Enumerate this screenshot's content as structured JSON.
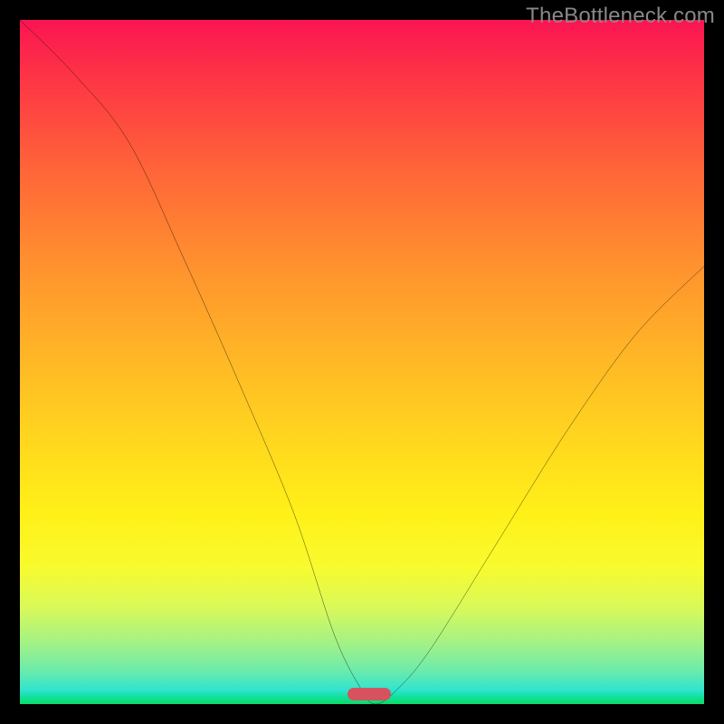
{
  "watermark": "TheBottleneck.com",
  "icon_names": {
    "gradient_label": "bottleneck-heatmap-gradient",
    "curve_label": "bottleneck-curve",
    "marker_label": "optimal-point-marker"
  },
  "chart_data": {
    "type": "line",
    "title": "",
    "xlabel": "",
    "ylabel": "",
    "xlim": [
      0,
      100
    ],
    "ylim": [
      0,
      100
    ],
    "grid": false,
    "legend": false,
    "series": [
      {
        "name": "bottleneck_curve",
        "x": [
          0,
          8,
          16,
          24,
          32,
          40,
          46,
          50,
          52,
          55,
          60,
          70,
          80,
          90,
          100
        ],
        "values": [
          100,
          92,
          82,
          65,
          47,
          28,
          10,
          2,
          0,
          2,
          8,
          24,
          40,
          54,
          64
        ]
      }
    ],
    "gradient_stops": [
      {
        "pos": 0,
        "color": "#fb1453"
      },
      {
        "pos": 22,
        "color": "#ff6538"
      },
      {
        "pos": 48,
        "color": "#ffb327"
      },
      {
        "pos": 72,
        "color": "#fff018"
      },
      {
        "pos": 91,
        "color": "#a4f285"
      },
      {
        "pos": 100,
        "color": "#0bdc66"
      }
    ],
    "marker": {
      "x": 51,
      "y": 1.5,
      "color": "#d6525e"
    }
  }
}
